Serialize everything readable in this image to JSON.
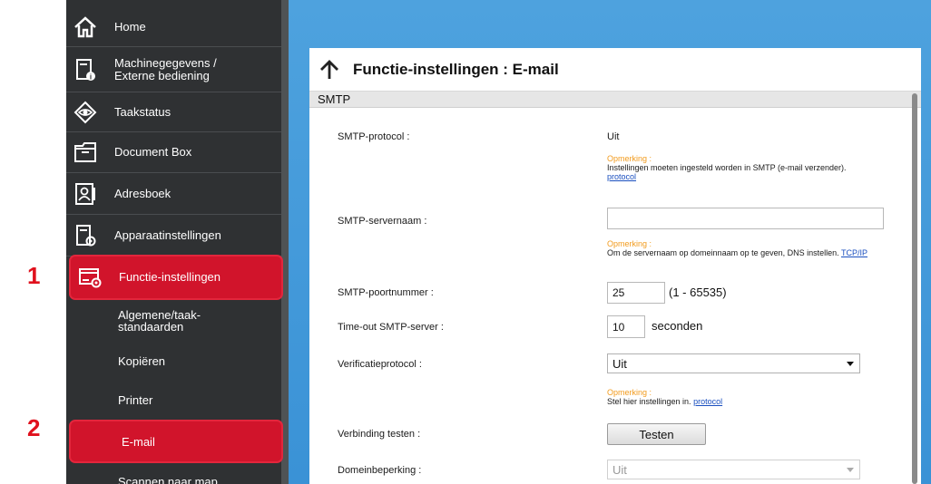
{
  "sidebar": {
    "items": [
      {
        "label": "Home",
        "icon": "home-icon"
      },
      {
        "label_line1": "Machinegegevens /",
        "label_line2": "Externe bediening",
        "icon": "device-info-icon"
      },
      {
        "label": "Taakstatus",
        "icon": "eye-icon"
      },
      {
        "label": "Document Box",
        "icon": "folder-icon"
      },
      {
        "label": "Adresboek",
        "icon": "address-book-icon"
      },
      {
        "label": "Apparaatinstellingen",
        "icon": "device-settings-icon"
      },
      {
        "label": "Functie-instellingen",
        "icon": "function-settings-icon",
        "active": true
      }
    ],
    "subitems": [
      {
        "label_line1": "Algemene/taak-",
        "label_line2": "standaarden"
      },
      {
        "label": "Kopiëren"
      },
      {
        "label": "Printer"
      },
      {
        "label": "E-mail",
        "active": true
      },
      {
        "label": "Scannen naar map"
      }
    ]
  },
  "badges": {
    "step1": "1",
    "step2": "2"
  },
  "panel": {
    "title": "Functie-instellingen : E-mail",
    "section": "SMTP",
    "rows": {
      "smtp_protocol": {
        "label": "SMTP-protocol :",
        "value": "Uit"
      },
      "note1": {
        "heading": "Opmerking :",
        "text": "Instellingen moeten ingesteld worden in SMTP (e-mail verzender).",
        "link": "protocol"
      },
      "server_name": {
        "label": "SMTP-servernaam :",
        "value": ""
      },
      "note2": {
        "heading": "Opmerking :",
        "text": "Om de servernaam op domeinnaam op te geven, DNS instellen.",
        "link": "TCP/IP"
      },
      "port": {
        "label": "SMTP-poortnummer :",
        "value": "25",
        "unit": "(1 - 65535)"
      },
      "timeout": {
        "label": "Time-out SMTP-server :",
        "value": "10",
        "unit": "seconden"
      },
      "verification": {
        "label": "Verificatieprotocol :",
        "value": "Uit"
      },
      "note3": {
        "heading": "Opmerking :",
        "text": "Stel hier instellingen in.",
        "link": "protocol"
      },
      "test": {
        "label": "Verbinding testen :",
        "button": "Testen"
      },
      "domain": {
        "label": "Domeinbeperking :",
        "value": "Uit"
      }
    }
  },
  "colors": {
    "accent_red": "#d1142b",
    "sidebar_bg": "#2f3133",
    "main_bg": "#3a92d6",
    "note_orange": "#f29b1d",
    "link_blue": "#1a4fbf"
  }
}
